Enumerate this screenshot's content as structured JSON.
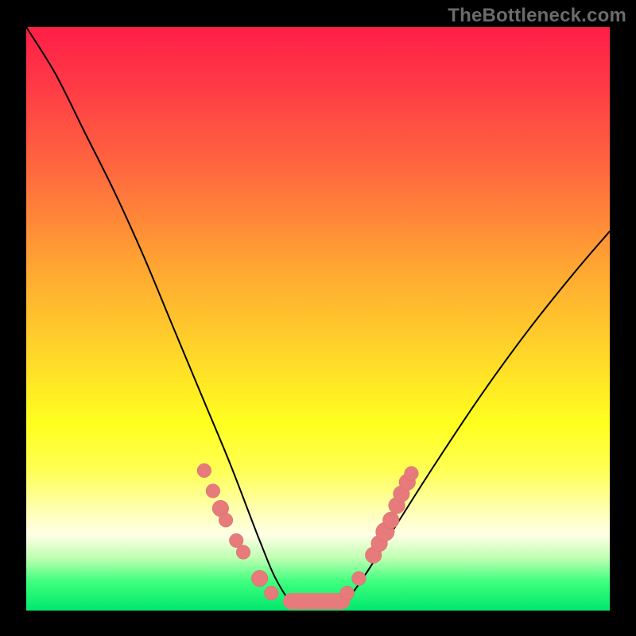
{
  "watermark": "TheBottleneck.com",
  "colors": {
    "curve": "#000000",
    "marker_fill": "#e77a7a",
    "marker_stroke": "#d86a6a",
    "background_black": "#000000"
  },
  "chart_data": {
    "type": "line",
    "title": "",
    "xlabel": "",
    "ylabel": "",
    "xlim": [
      0,
      100
    ],
    "ylim": [
      0,
      100
    ],
    "grid": false,
    "annotations": [
      "TheBottleneck.com"
    ],
    "series": [
      {
        "name": "bottleneck-curve-left",
        "x": [
          0,
          5,
          10,
          15,
          20,
          25,
          30,
          35,
          40,
          43,
          46
        ],
        "y": [
          100,
          92,
          82,
          72,
          61,
          49,
          37,
          25,
          12,
          5,
          1
        ]
      },
      {
        "name": "bottleneck-curve-flat",
        "x": [
          46,
          50,
          54
        ],
        "y": [
          1,
          0.5,
          1
        ]
      },
      {
        "name": "bottleneck-curve-right",
        "x": [
          54,
          58,
          63,
          70,
          78,
          86,
          94,
          100
        ],
        "y": [
          1,
          6,
          14,
          25,
          37,
          48,
          58,
          65
        ]
      }
    ],
    "markers": [
      {
        "x": 30.5,
        "y": 24,
        "r": 1.2
      },
      {
        "x": 32.0,
        "y": 20.5,
        "r": 1.2
      },
      {
        "x": 33.3,
        "y": 17.5,
        "r": 1.4
      },
      {
        "x": 34.2,
        "y": 15.5,
        "r": 1.2
      },
      {
        "x": 36.0,
        "y": 12.0,
        "r": 1.2
      },
      {
        "x": 37.2,
        "y": 10.0,
        "r": 1.2
      },
      {
        "x": 40.0,
        "y": 5.5,
        "r": 1.4
      },
      {
        "x": 42.0,
        "y": 3.0,
        "r": 1.2
      },
      {
        "x": 55.0,
        "y": 3.0,
        "r": 1.2
      },
      {
        "x": 57.0,
        "y": 5.5,
        "r": 1.2
      },
      {
        "x": 59.5,
        "y": 9.5,
        "r": 1.4
      },
      {
        "x": 60.5,
        "y": 11.5,
        "r": 1.4
      },
      {
        "x": 61.5,
        "y": 13.5,
        "r": 1.6
      },
      {
        "x": 62.5,
        "y": 15.5,
        "r": 1.4
      },
      {
        "x": 63.5,
        "y": 18.0,
        "r": 1.4
      },
      {
        "x": 64.3,
        "y": 20.0,
        "r": 1.4
      },
      {
        "x": 65.3,
        "y": 22.0,
        "r": 1.4
      },
      {
        "x": 66.0,
        "y": 23.5,
        "r": 1.2
      }
    ],
    "flat_segment": {
      "x0": 44,
      "x1": 55.5,
      "y": 1.6,
      "thickness": 2.8
    }
  }
}
